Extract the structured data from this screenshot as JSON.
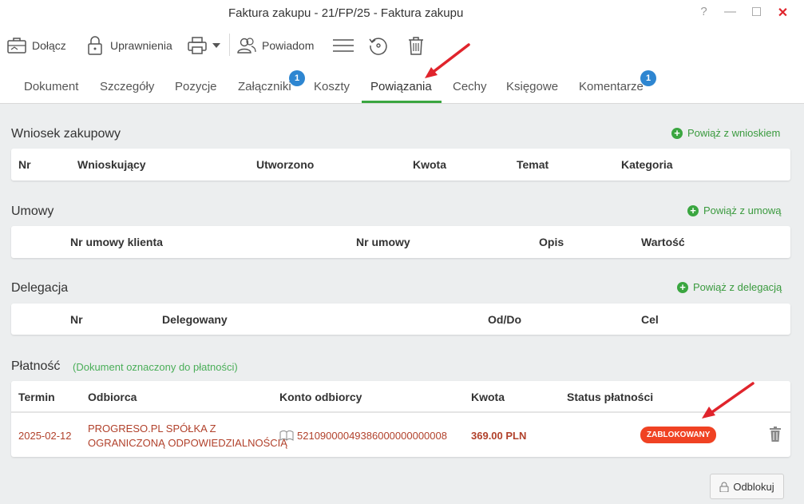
{
  "window": {
    "title": "Faktura zakupu - 21/FP/25 - Faktura zakupu",
    "help": "?",
    "minimize": "—",
    "maximize": "☐",
    "close": "✕"
  },
  "toolbar": {
    "attach_label": "Dołącz",
    "permissions_label": "Uprawnienia",
    "notify_label": "Powiadom"
  },
  "tabs": [
    {
      "label": "Dokument"
    },
    {
      "label": "Szczegóły"
    },
    {
      "label": "Pozycje"
    },
    {
      "label": "Załączniki",
      "badge": "1"
    },
    {
      "label": "Koszty"
    },
    {
      "label": "Powiązania"
    },
    {
      "label": "Cechy"
    },
    {
      "label": "Księgowe"
    },
    {
      "label": "Komentarze",
      "badge": "1"
    }
  ],
  "sections": {
    "wniosek": {
      "title": "Wniosek zakupowy",
      "action": "Powiąż z wnioskiem",
      "columns": [
        "Nr",
        "Wnioskujący",
        "Utworzono",
        "Kwota",
        "Temat",
        "Kategoria"
      ]
    },
    "umowy": {
      "title": "Umowy",
      "action": "Powiąż z umową",
      "columns": [
        "Nr umowy klienta",
        "Nr umowy",
        "Opis",
        "Wartość"
      ]
    },
    "delegacja": {
      "title": "Delegacja",
      "action": "Powiąż z delegacją",
      "columns": [
        "Nr",
        "Delegowany",
        "Od/Do",
        "Cel"
      ]
    },
    "platnosc": {
      "title": "Płatność",
      "note": "(Dokument oznaczony do płatności)",
      "columns": [
        "Termin",
        "Odbiorca",
        "Konto odbiorcy",
        "Kwota",
        "Status płatności"
      ],
      "row": {
        "termin": "2025-02-12",
        "odbiorca_line1": "PROGRESO.PL SPÓŁKA Z",
        "odbiorca_line2": "OGRANICZONĄ ODPOWIEDZIALNOŚCIĄ",
        "konto": "52109000049386000000000008",
        "kwota": "369.00 PLN",
        "status": "ZABLOKOWANY"
      },
      "unlock_label": "Odblokuj"
    }
  },
  "colors": {
    "accent_green": "#3aa640",
    "badge_blue": "#2e86d1",
    "status_red": "#f04223",
    "row_text": "#b1412b",
    "arrow_red": "#e0242c"
  }
}
